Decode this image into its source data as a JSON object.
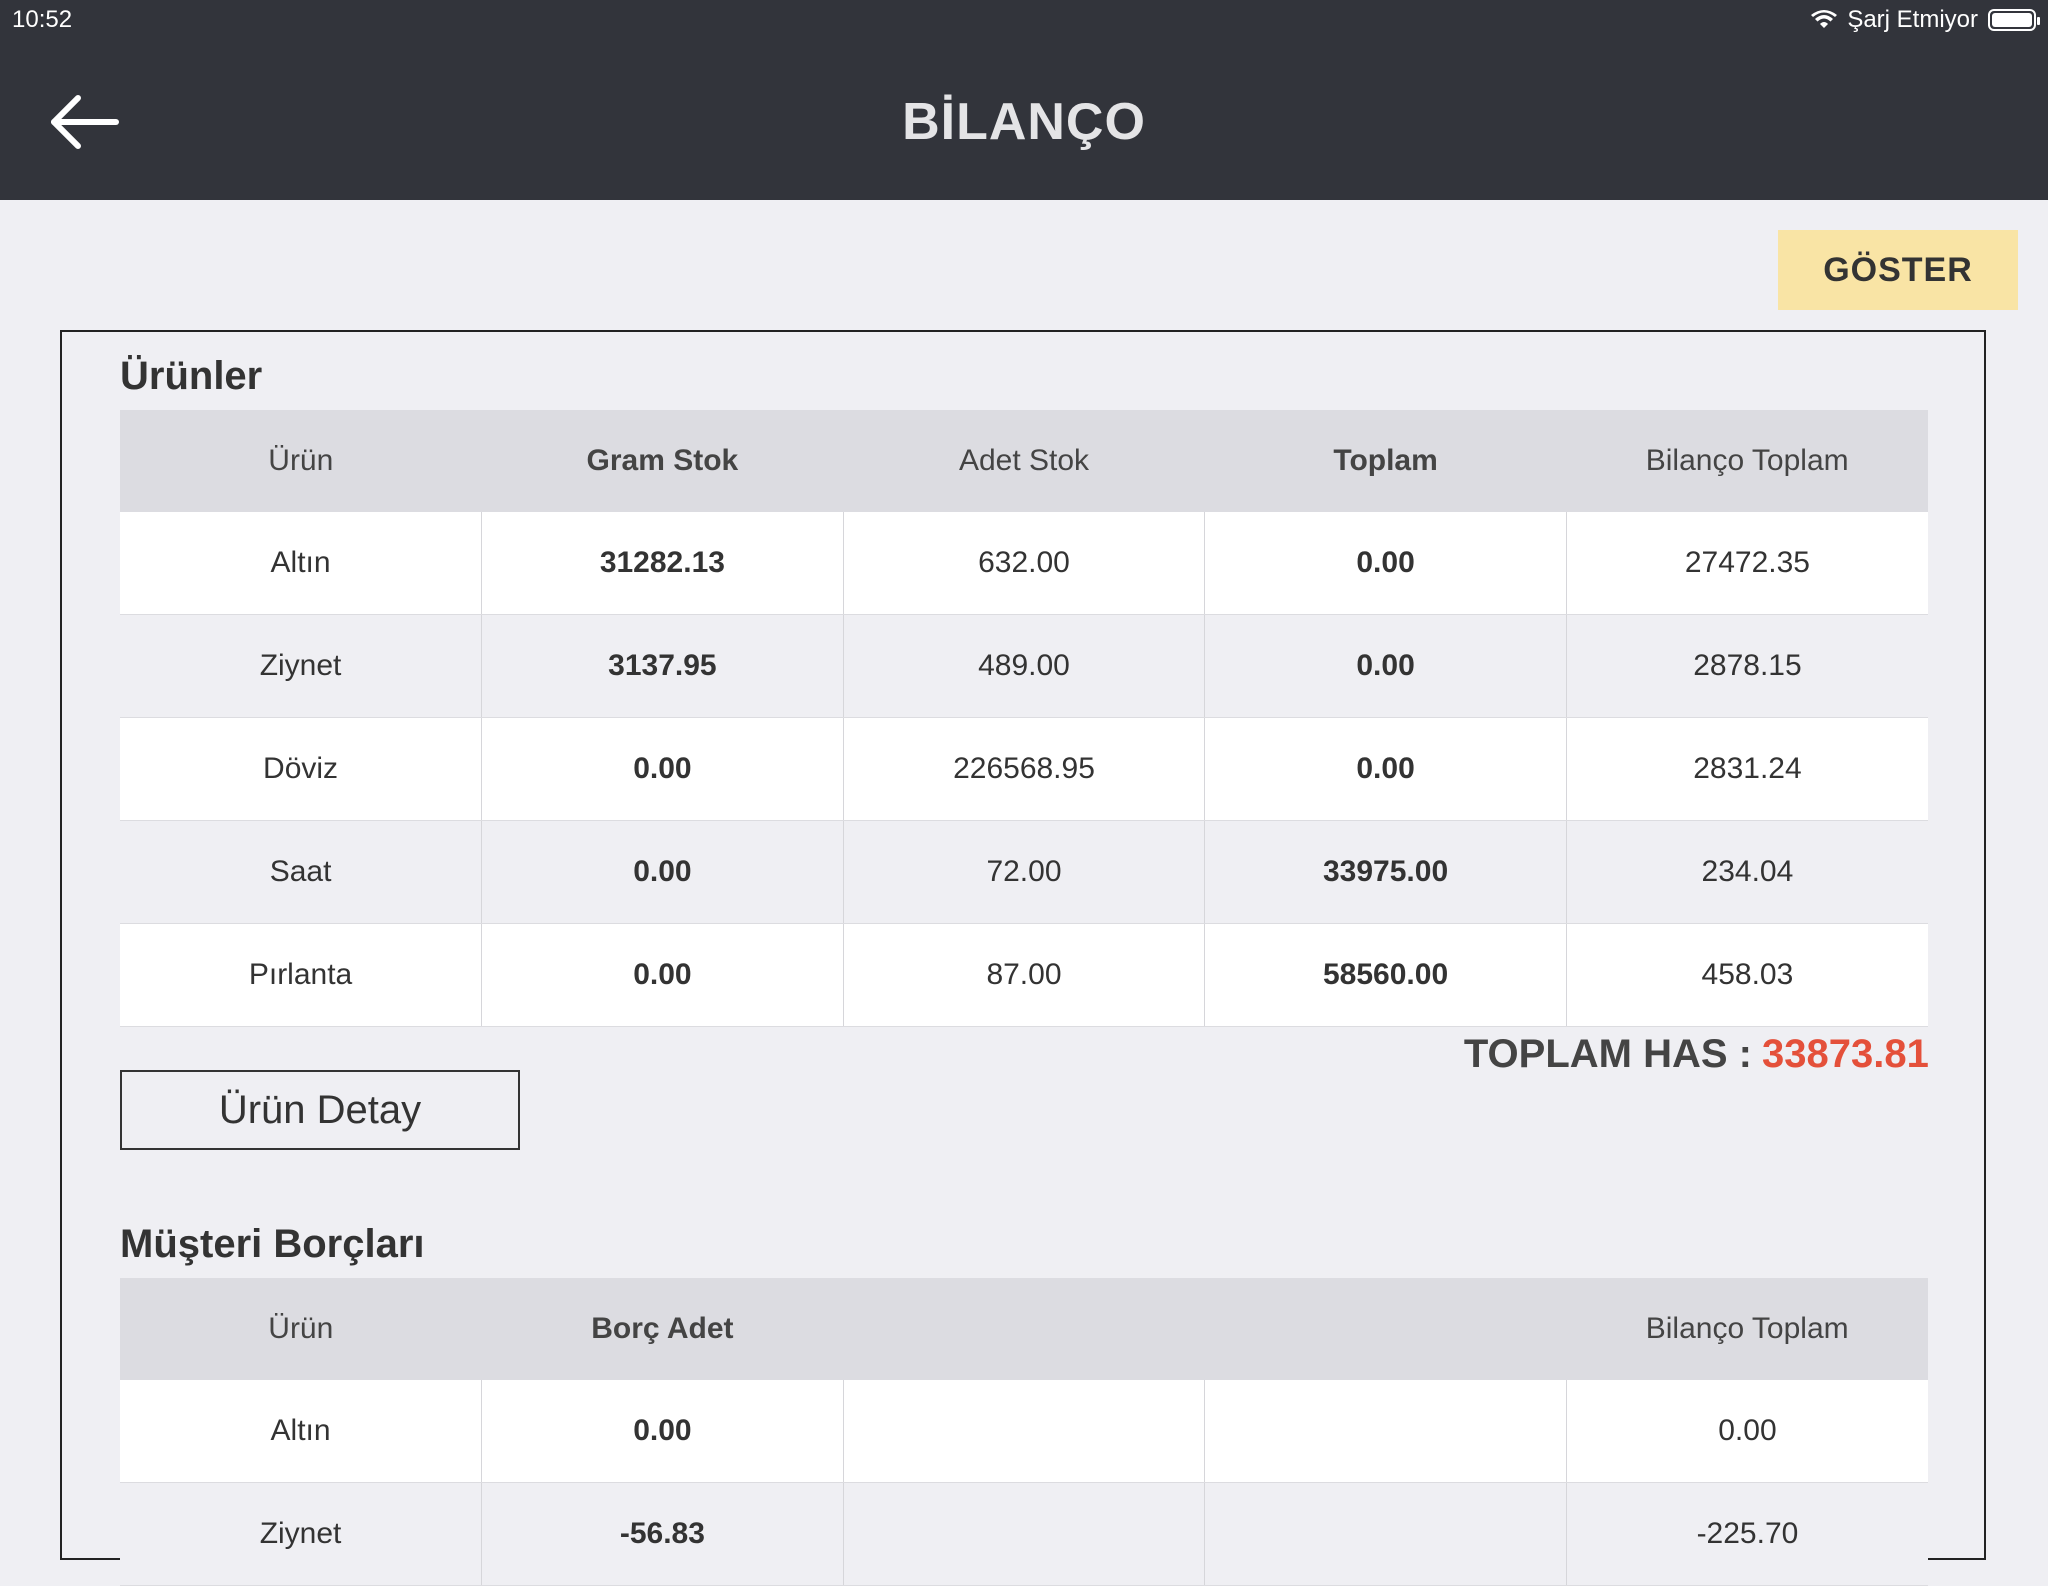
{
  "status_bar": {
    "time": "10:52",
    "charging_text": "Şarj Etmiyor"
  },
  "nav": {
    "title": "BİLANÇO",
    "back_icon": "arrow-left-icon"
  },
  "show_button": "GÖSTER",
  "products": {
    "title": "Ürünler",
    "headers": [
      "Ürün",
      "Gram Stok",
      "Adet Stok",
      "Toplam",
      "Bilanço Toplam"
    ],
    "rows": [
      [
        "Altın",
        "31282.13",
        "632.00",
        "0.00",
        "27472.35"
      ],
      [
        "Ziynet",
        "3137.95",
        "489.00",
        "0.00",
        "2878.15"
      ],
      [
        "Döviz",
        "0.00",
        "226568.95",
        "0.00",
        "2831.24"
      ],
      [
        "Saat",
        "0.00",
        "72.00",
        "33975.00",
        "234.04"
      ],
      [
        "Pırlanta",
        "0.00",
        "87.00",
        "58560.00",
        "458.03"
      ]
    ],
    "total_label": "TOPLAM HAS :",
    "total_value": "33873.81",
    "detail_button": "Ürün Detay"
  },
  "debts": {
    "title": "Müşteri Borçları",
    "headers": [
      "Ürün",
      "Borç Adet",
      "",
      "",
      "Bilanço Toplam"
    ],
    "rows": [
      [
        "Altın",
        "0.00",
        "",
        "",
        "0.00"
      ],
      [
        "Ziynet",
        "-56.83",
        "",
        "",
        "-225.70"
      ]
    ]
  },
  "colors": {
    "navbar": "#32343b",
    "background": "#efeff3",
    "accent_button": "#f9e4a5",
    "total_value": "#e4503a"
  }
}
